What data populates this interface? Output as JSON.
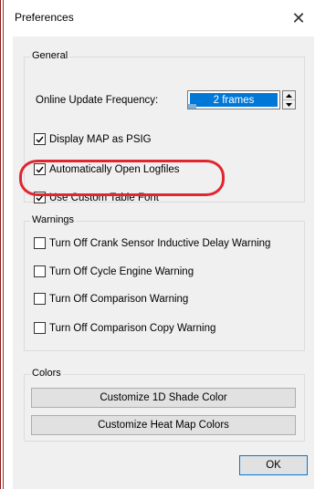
{
  "window": {
    "title": "Preferences",
    "close_glyph": "✕"
  },
  "general": {
    "legend": "General",
    "online_update_label": "Online Update Frequency:",
    "online_update_value": "2 frames",
    "display_map_label": "Display MAP as PSIG",
    "display_map_checked": true,
    "auto_open_label": "Automatically Open Logfiles",
    "auto_open_checked": true,
    "custom_font_label": "Use Custom Table Font",
    "custom_font_checked": true
  },
  "warnings": {
    "legend": "Warnings",
    "items": [
      {
        "label": "Turn Off Crank Sensor Inductive Delay Warning",
        "checked": false
      },
      {
        "label": "Turn Off Cycle Engine Warning",
        "checked": false
      },
      {
        "label": "Turn Off Comparison Warning",
        "checked": false
      },
      {
        "label": "Turn Off Comparison Copy Warning",
        "checked": false
      }
    ]
  },
  "colors": {
    "legend": "Colors",
    "shade_button": "Customize 1D Shade Color",
    "heatmap_button": "Customize Heat Map Colors"
  },
  "footer": {
    "ok_label": "OK"
  },
  "icons": {
    "close": "close-icon",
    "spin_up": "arrow-up-icon",
    "spin_down": "arrow-down-icon",
    "check": "checkmark-icon"
  },
  "theme": {
    "accent": "#0078d7",
    "annotation": "#e0262e",
    "panel": "#f0f0f0"
  }
}
